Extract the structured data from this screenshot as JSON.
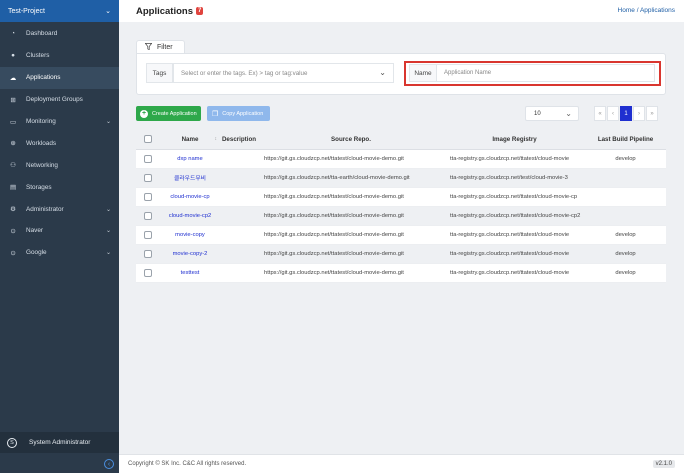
{
  "sidebar": {
    "project": "Test-Project",
    "items": [
      {
        "label": "Dashboard",
        "icon": "dashboard-icon",
        "caret": false,
        "active": false
      },
      {
        "label": "Clusters",
        "icon": "clusters-icon",
        "caret": false,
        "active": false
      },
      {
        "label": "Applications",
        "icon": "applications-icon",
        "caret": false,
        "active": true
      },
      {
        "label": "Deployment Groups",
        "icon": "deployment-groups-icon",
        "caret": false,
        "active": false
      },
      {
        "label": "Monitoring",
        "icon": "monitoring-icon",
        "caret": true,
        "active": false
      },
      {
        "label": "Workloads",
        "icon": "workloads-icon",
        "caret": false,
        "active": false
      },
      {
        "label": "Networking",
        "icon": "networking-icon",
        "caret": false,
        "active": false
      },
      {
        "label": "Storages",
        "icon": "storages-icon",
        "caret": false,
        "active": false
      },
      {
        "label": "Administrator",
        "icon": "administrator-icon",
        "caret": true,
        "active": false
      },
      {
        "label": "Naver",
        "icon": "naver-icon",
        "caret": true,
        "active": false
      },
      {
        "label": "Google",
        "icon": "google-icon",
        "caret": true,
        "active": false
      }
    ],
    "admin_badge": "S",
    "admin_label": "System Administrator"
  },
  "header": {
    "title": "Applications",
    "count": "7",
    "breadcrumb": "Home / Applications"
  },
  "filter": {
    "tab_label": "Filter",
    "tags_label": "Tags",
    "tags_placeholder": "Select or enter the tags. Ex) > tag or tag:value",
    "name_label": "Name",
    "name_placeholder": "Application Name"
  },
  "toolbar": {
    "create_label": "Create Application",
    "copy_label": "Copy Application",
    "page_size": "10",
    "pager": [
      "«",
      "‹",
      "1",
      "›",
      "»"
    ]
  },
  "table": {
    "headers": [
      "Name",
      "Description",
      "Source Repo.",
      "Image Registry",
      "Last Build Pipeline"
    ],
    "rows": [
      {
        "name": "dxp name",
        "description": "",
        "source": "https://git.gs.cloudzcp.net/ttatest/cloud-movie-demo.git",
        "registry": "tta-registry.gs.cloudzcp.net/ttatest/cloud-movie",
        "pipeline": "develop"
      },
      {
        "name": "클라우드무비",
        "description": "",
        "source": "https://git.gs.cloudzcp.net/tta-earth/cloud-movie-demo.git",
        "registry": "tta-registry.gs.cloudzcp.net/test/cloud-movie-3",
        "pipeline": ""
      },
      {
        "name": "cloud-movie-cp",
        "description": "",
        "source": "https://git.gs.cloudzcp.net/ttatest/cloud-movie-demo.git",
        "registry": "tta-registry.gs.cloudzcp.net/ttatest/cloud-movie-cp",
        "pipeline": ""
      },
      {
        "name": "cloud-movie-cp2",
        "description": "",
        "source": "https://git.gs.cloudzcp.net/ttatest/cloud-movie-demo.git",
        "registry": "tta-registry.gs.cloudzcp.net/ttatest/cloud-movie-cp2",
        "pipeline": ""
      },
      {
        "name": "movie-copy",
        "description": "",
        "source": "https://git.gs.cloudzcp.net/ttatest/cloud-movie-demo.git",
        "registry": "tta-registry.gs.cloudzcp.net/ttatest/cloud-movie",
        "pipeline": "develop"
      },
      {
        "name": "movie-copy-2",
        "description": "",
        "source": "https://git.gs.cloudzcp.net/ttatest/cloud-movie-demo.git",
        "registry": "tta-registry.gs.cloudzcp.net/ttatest/cloud-movie",
        "pipeline": "develop"
      },
      {
        "name": "testtest",
        "description": "",
        "source": "https://git.gs.cloudzcp.net/ttatest/cloud-movie-demo.git",
        "registry": "tta-registry.gs.cloudzcp.net/ttatest/cloud-movie",
        "pipeline": "develop"
      }
    ]
  },
  "footer": {
    "copyright": "Copyright © SK Inc. C&C All rights reserved.",
    "version": "v2.1.0"
  },
  "colors": {
    "sidebar": "#2b3a4a",
    "project_bar": "#1f5fa6",
    "create_button": "#2ea84a",
    "copy_button": "#8fb8ec",
    "highlight_box": "#d9362f",
    "link": "#1f2fd0"
  }
}
